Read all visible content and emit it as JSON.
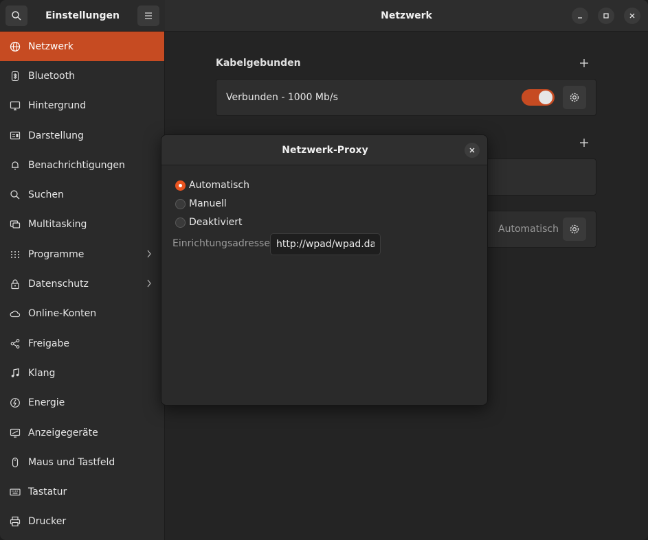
{
  "sidebar": {
    "title": "Einstellungen",
    "items": [
      {
        "label": "Netzwerk",
        "icon": "globe-icon",
        "active": true
      },
      {
        "label": "Bluetooth",
        "icon": "bluetooth-icon"
      },
      {
        "label": "Hintergrund",
        "icon": "monitor-icon"
      },
      {
        "label": "Darstellung",
        "icon": "appearance-icon"
      },
      {
        "label": "Benachrichtigungen",
        "icon": "bell-icon"
      },
      {
        "label": "Suchen",
        "icon": "search-icon"
      },
      {
        "label": "Multitasking",
        "icon": "multitasking-icon"
      },
      {
        "label": "Programme",
        "icon": "apps-grid-icon",
        "chevron": true
      },
      {
        "label": "Datenschutz",
        "icon": "lock-icon",
        "chevron": true
      },
      {
        "label": "Online-Konten",
        "icon": "cloud-icon"
      },
      {
        "label": "Freigabe",
        "icon": "share-icon"
      },
      {
        "label": "Klang",
        "icon": "music-note-icon"
      },
      {
        "label": "Energie",
        "icon": "power-icon"
      },
      {
        "label": "Anzeigegeräte",
        "icon": "display-icon"
      },
      {
        "label": "Maus und Tastfeld",
        "icon": "mouse-icon"
      },
      {
        "label": "Tastatur",
        "icon": "keyboard-icon"
      },
      {
        "label": "Drucker",
        "icon": "printer-icon"
      }
    ]
  },
  "header": {
    "title": "Netzwerk"
  },
  "main": {
    "wired_title": "Kabelgebunden",
    "wired_status": "Verbunden - 1000 Mb/s",
    "wired_enabled": true,
    "proxy_value": "Automatisch"
  },
  "dialog": {
    "title": "Netzwerk-Proxy",
    "options": [
      "Automatisch",
      "Manuell",
      "Deaktiviert"
    ],
    "selected": "Automatisch",
    "address_label": "Einrichtungsadresse",
    "address_value": "http://wpad/wpad.dat"
  },
  "colors": {
    "accent": "#c64b22",
    "radio_on": "#e95420"
  }
}
